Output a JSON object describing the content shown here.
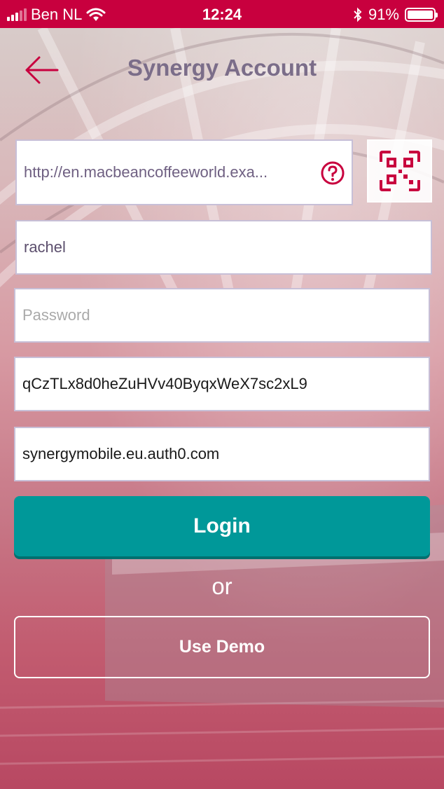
{
  "status_bar": {
    "carrier": "Ben NL",
    "time": "12:24",
    "battery": "91%",
    "battery_level": 0.91,
    "signal_bars": 3,
    "icons": [
      "signal-icon",
      "wifi-icon",
      "bluetooth-icon",
      "battery-icon"
    ]
  },
  "header": {
    "title": "Synergy Account",
    "back_icon": "arrow-left-icon"
  },
  "form": {
    "server_url": "http://en.macbeancoffeeworld.exa...",
    "help_icon": "question-circle-icon",
    "qr_icon": "qr-code-icon",
    "username": "rachel",
    "password_placeholder": "Password",
    "client_id": "qCzTLx8d0heZuHVv40ByqxWeX7sc2xL9",
    "auth_domain": "synergymobile.eu.auth0.com"
  },
  "actions": {
    "login_label": "Login",
    "or_label": "or",
    "demo_label": "Use Demo"
  },
  "colors": {
    "status_bar": "#c8003e",
    "accent": "#c8003e",
    "title": "#7b6d89",
    "login_button": "#009899"
  }
}
